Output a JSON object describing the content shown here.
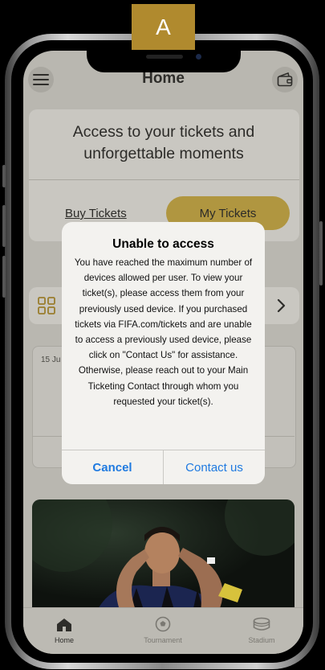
{
  "badge": {
    "letter": "A"
  },
  "header": {
    "title": "Home"
  },
  "access_card": {
    "title": "Access to your tickets and unforgettable moments",
    "buy_tickets": "Buy Tickets",
    "my_tickets": "My Tickets"
  },
  "event": {
    "date": "15 Ju"
  },
  "dialog": {
    "title": "Unable to access",
    "message": "You have reached the maximum number of devices allowed per user. To view your ticket(s), please access them from your previously used device. If you purchased tickets via FIFA.com/tickets and are unable to access a previously used device, please click on \"Contact Us\" for assistance. Otherwise, please reach out to your Main Ticketing Contact through whom you requested your ticket(s).",
    "cancel": "Cancel",
    "contact": "Contact us"
  },
  "tabs": [
    {
      "label": "Home",
      "icon": "home-icon",
      "active": true
    },
    {
      "label": "Tournament",
      "icon": "soccer-ball-icon",
      "active": false
    },
    {
      "label": "Stadium",
      "icon": "stadium-icon",
      "active": false
    }
  ],
  "colors": {
    "accent": "#b09640",
    "link": "#1f7ae0",
    "badge": "#b08a2e"
  }
}
